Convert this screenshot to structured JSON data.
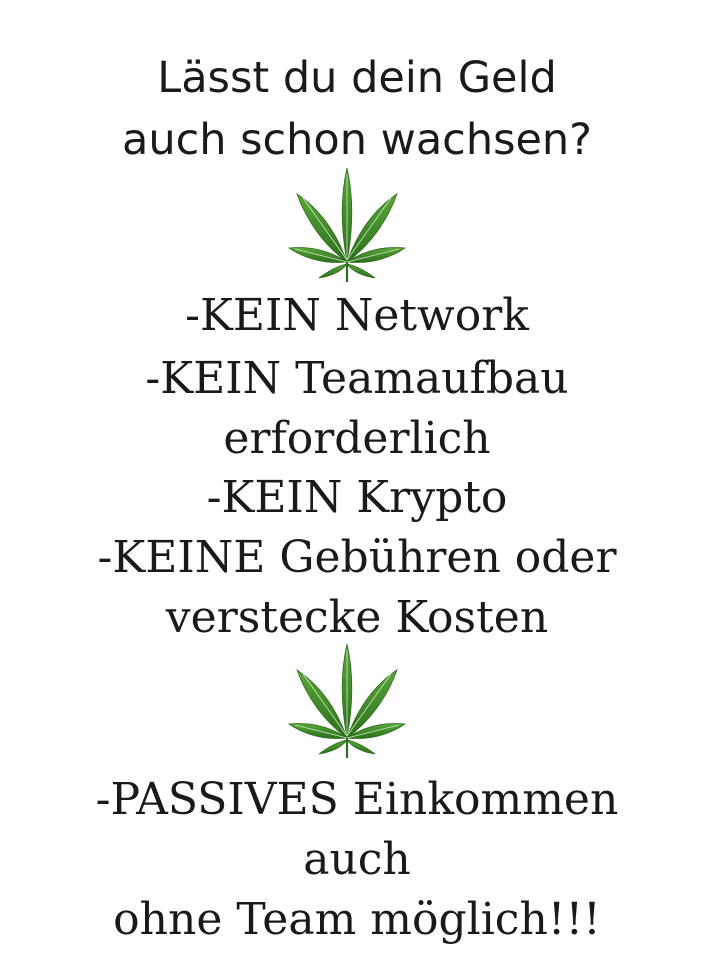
{
  "heading": {
    "line1": "Lässt du dein Geld",
    "line2": "auch schon wachsen?"
  },
  "icons": {
    "leaf": "cannabis-leaf-icon",
    "leaf_color": "#3f8f2a",
    "leaf_dark": "#2c6e1c"
  },
  "list": {
    "item1": "-KEIN Network",
    "item2_line1": "-KEIN Teamaufbau",
    "item2_line2": "erforderlich",
    "item3": "-KEIN Krypto",
    "item4_line1": "-KEINE Gebühren oder",
    "item4_line2": "verstecke Kosten"
  },
  "footer": {
    "line1": "-PASSIVES Einkommen",
    "line2": "auch",
    "line3": "ohne Team möglich!!!"
  }
}
